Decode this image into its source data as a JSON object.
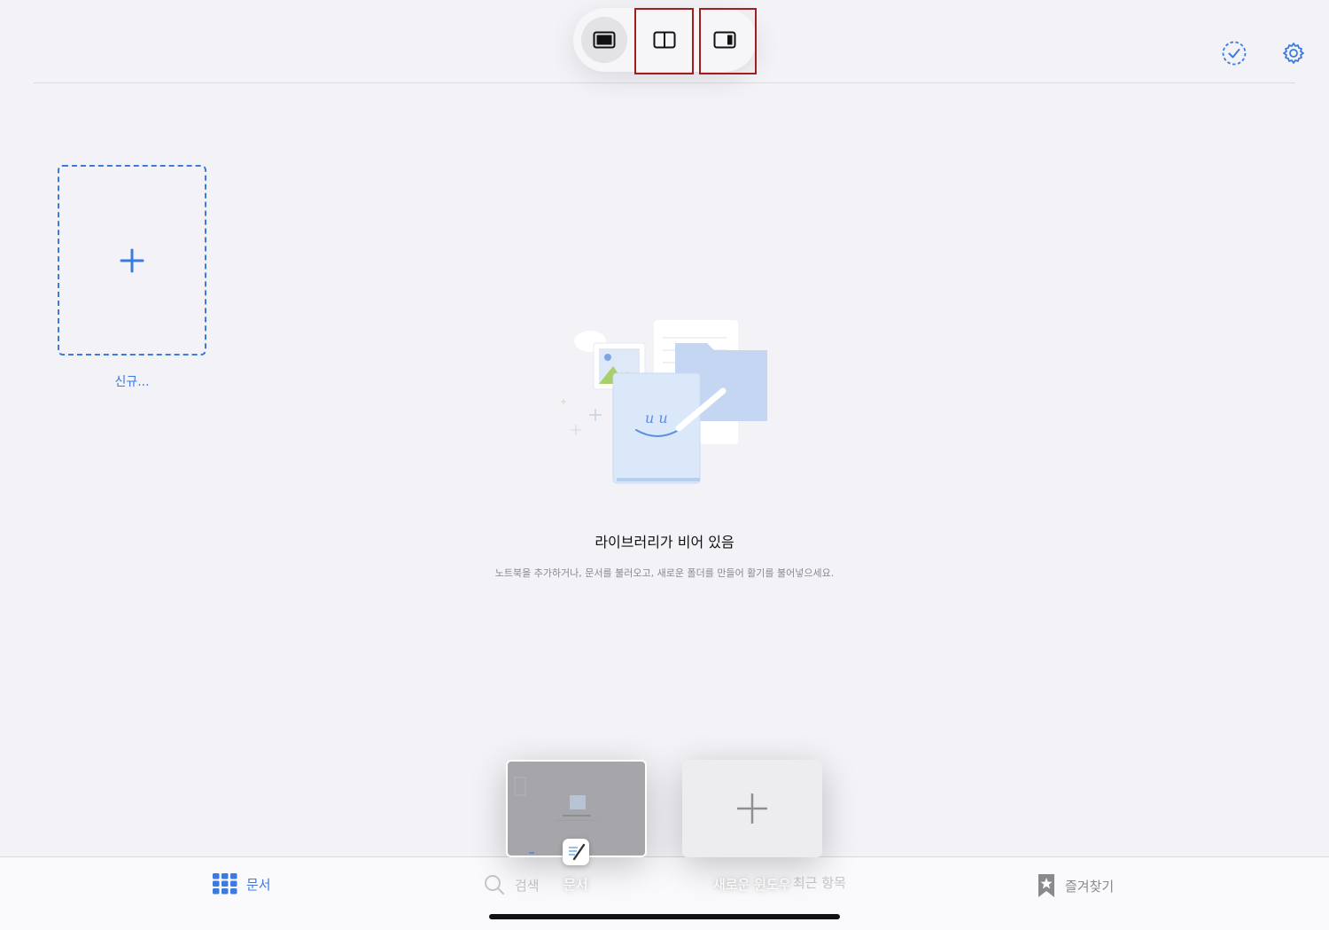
{
  "colors": {
    "accent": "#3c7ae0",
    "background": "#f2f2f7",
    "highlight": "#a01e1e"
  },
  "multitasking": {
    "buttons": [
      {
        "icon": "full-screen-icon",
        "state": "active"
      },
      {
        "icon": "split-view-icon",
        "state": "highlighted"
      },
      {
        "icon": "slide-over-icon",
        "state": "highlighted"
      }
    ]
  },
  "toolbar": {
    "select_icon": "select-circle-icon",
    "settings_icon": "gear-icon"
  },
  "library": {
    "new_label": "신규...",
    "empty_title": "라이브러리가 비어 있음",
    "empty_subtitle": "노트북을 추가하거나, 문서를 불러오고, 새로운 폴더를 만들어 활기를 불어넣으세요."
  },
  "tabbar": {
    "docs": "문서",
    "search": "검색",
    "recent": "최근 항목",
    "favorites": "즐겨찾기"
  },
  "shelf": {
    "docs_window_label": "문서",
    "new_window_label": "새로운 윈도우"
  }
}
